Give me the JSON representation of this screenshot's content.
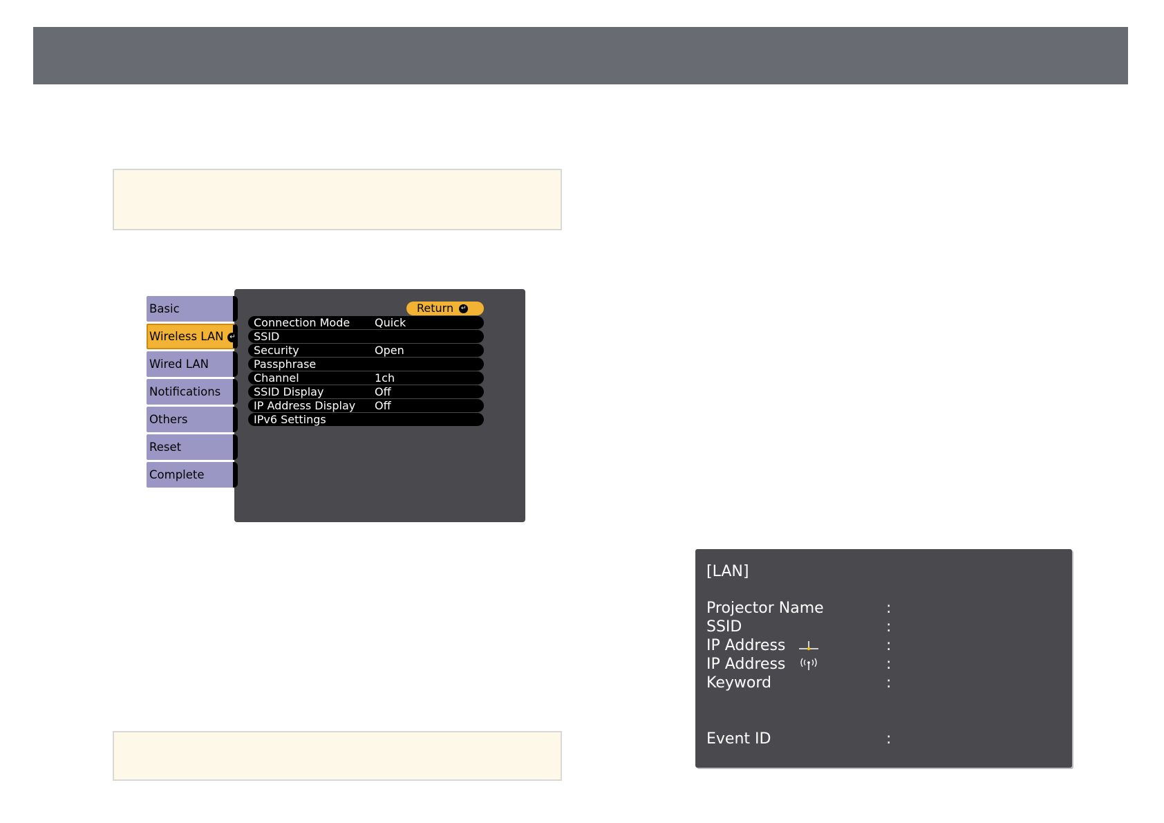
{
  "menu": {
    "tabs": [
      {
        "label": "Basic"
      },
      {
        "label": "Wireless LAN",
        "active": true
      },
      {
        "label": "Wired LAN"
      },
      {
        "label": "Notifications"
      },
      {
        "label": "Others"
      },
      {
        "label": "Reset"
      },
      {
        "label": "Complete"
      }
    ],
    "return_label": "Return",
    "rows": [
      {
        "label": "Connection Mode",
        "value": "Quick"
      },
      {
        "label": "SSID",
        "value": ""
      },
      {
        "label": "Security",
        "value": "Open"
      },
      {
        "label": "Passphrase",
        "value": ""
      },
      {
        "label": "Channel",
        "value": "1ch"
      },
      {
        "label": "SSID Display",
        "value": "Off"
      },
      {
        "label": "IP Address Display",
        "value": "Off"
      },
      {
        "label": "IPv6 Settings",
        "value": ""
      }
    ]
  },
  "lan": {
    "title": "[LAN]",
    "colon": ":",
    "rows": [
      {
        "label": "Projector Name",
        "icon": ""
      },
      {
        "label": "SSID",
        "icon": ""
      },
      {
        "label": "IP Address",
        "icon": "wired-network-icon"
      },
      {
        "label": "IP Address",
        "icon": "wireless-signal-icon"
      },
      {
        "label": "Keyword",
        "icon": ""
      },
      {
        "label": "Event ID",
        "icon": ""
      }
    ]
  },
  "colors": {
    "header": "#696b72",
    "note_bg": "#fdf8e8",
    "tab": "#9b97c4",
    "tab_active": "#f2b233",
    "panel": "#4a4a4e"
  }
}
